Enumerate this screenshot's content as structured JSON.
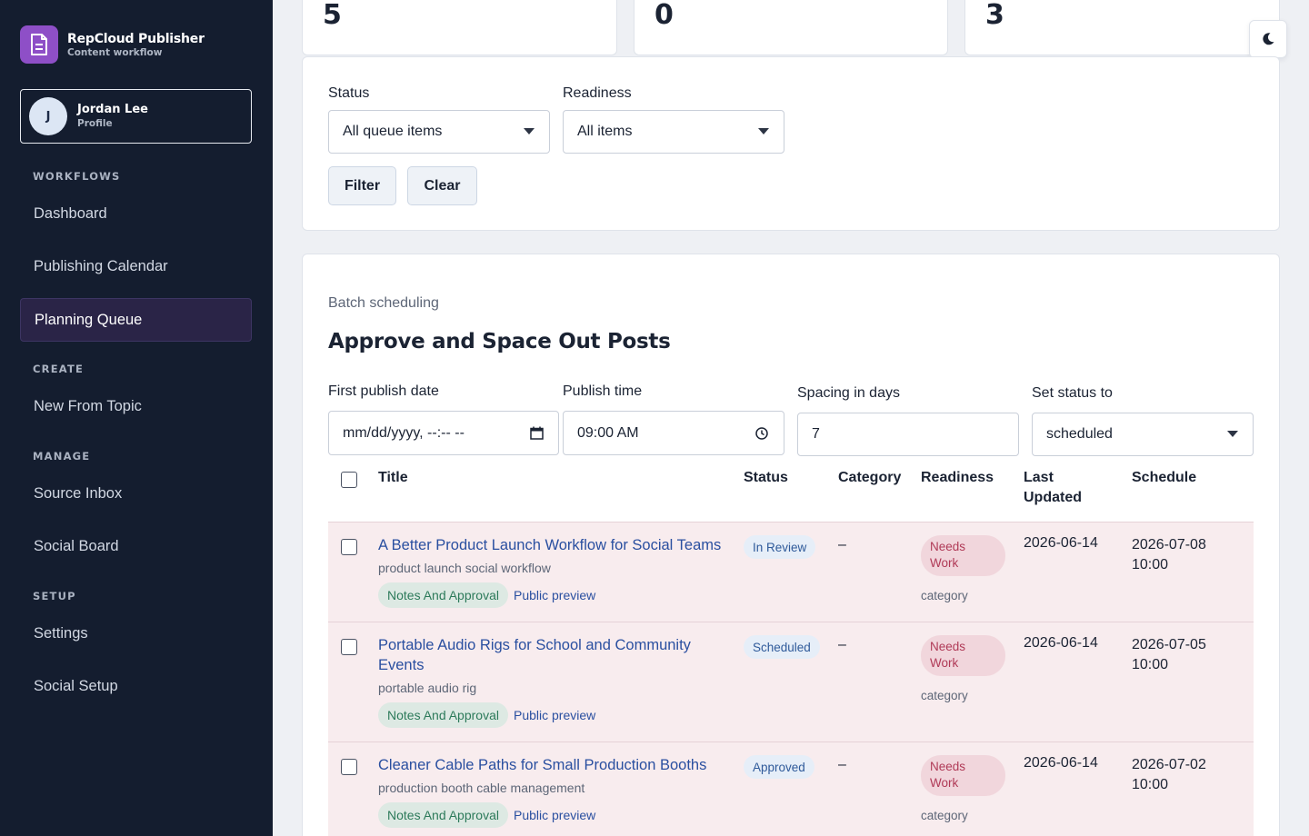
{
  "app": {
    "title": "RepCloud Publisher",
    "subtitle": "Content workflow"
  },
  "profile": {
    "initial": "J",
    "name": "Jordan Lee",
    "label": "Profile"
  },
  "nav": {
    "sections": [
      {
        "heading": "WORKFLOWS",
        "items": [
          "Dashboard",
          "Publishing Calendar",
          "Planning Queue"
        ]
      },
      {
        "heading": "CREATE",
        "items": [
          "New From Topic"
        ]
      },
      {
        "heading": "MANAGE",
        "items": [
          "Source Inbox",
          "Social Board"
        ]
      },
      {
        "heading": "SETUP",
        "items": [
          "Settings",
          "Social Setup"
        ]
      }
    ],
    "active": "Planning Queue"
  },
  "stats": [
    "5",
    "0",
    "3"
  ],
  "filters": {
    "status_label": "Status",
    "status_value": "All queue items",
    "readiness_label": "Readiness",
    "readiness_value": "All items",
    "filter_button": "Filter",
    "clear_button": "Clear"
  },
  "batch": {
    "kicker": "Batch scheduling",
    "title": "Approve and Space Out Posts",
    "first_date_label": "First publish date",
    "first_date_value": "mm/dd/yyyy, --:-- --",
    "time_label": "Publish time",
    "time_value": "09:00 AM",
    "spacing_label": "Spacing in days",
    "spacing_value": "7",
    "set_status_label": "Set status to",
    "set_status_value": "scheduled"
  },
  "table": {
    "headers": {
      "title": "Title",
      "status": "Status",
      "category": "Category",
      "readiness": "Readiness",
      "last_updated": "Last Updated",
      "schedule": "Schedule"
    },
    "rows": [
      {
        "title": "A Better Product Launch Workflow for Social Teams",
        "topic": "product launch social workflow",
        "tag": "Notes And Approval",
        "preview": "Public preview",
        "status": "In Review",
        "category": "–",
        "readiness": "Needs Work",
        "readiness_note": "category",
        "updated": "2026-06-14",
        "schedule": "2026-07-08 10:00"
      },
      {
        "title": "Portable Audio Rigs for School and Community Events",
        "topic": "portable audio rig",
        "tag": "Notes And Approval",
        "preview": "Public preview",
        "status": "Scheduled",
        "category": "–",
        "readiness": "Needs Work",
        "readiness_note": "category",
        "updated": "2026-06-14",
        "schedule": "2026-07-05 10:00"
      },
      {
        "title": "Cleaner Cable Paths for Small Production Booths",
        "topic": "production booth cable management",
        "tag": "Notes And Approval",
        "preview": "Public preview",
        "status": "Approved",
        "category": "–",
        "readiness": "Needs Work",
        "readiness_note": "category",
        "updated": "2026-06-14",
        "schedule": "2026-07-02 10:00"
      }
    ]
  },
  "colors": {
    "sidebar_bg": "#141d2f",
    "brand_accent": "#8e4fc7",
    "link": "#2a4fa0",
    "row_highlight": "#f8ecee",
    "needs_work": "#b03a57"
  },
  "icons": {
    "brand": "document-icon",
    "theme_toggle": "moon-icon"
  }
}
